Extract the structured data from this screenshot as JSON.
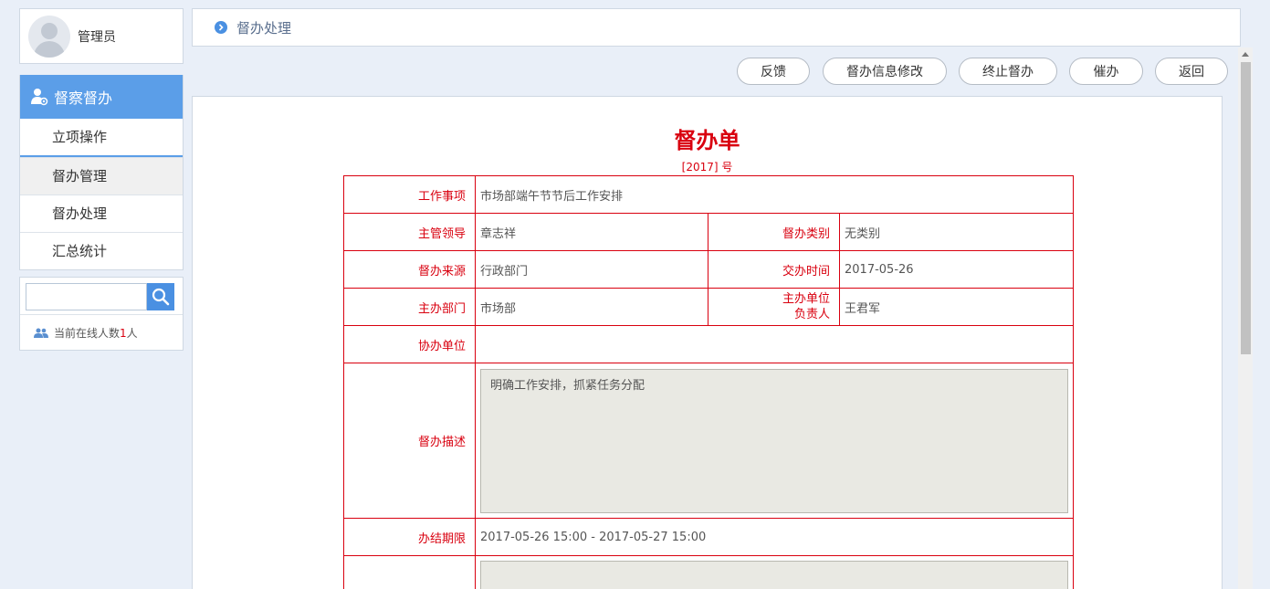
{
  "user": {
    "name": "管理员"
  },
  "nav": {
    "header": "督察督办",
    "items": [
      {
        "label": "立项操作"
      },
      {
        "label": "督办管理"
      },
      {
        "label": "督办处理"
      },
      {
        "label": "汇总统计"
      }
    ]
  },
  "search": {
    "placeholder": ""
  },
  "online": {
    "prefix": "当前在线人数",
    "count": "1",
    "suffix": "人"
  },
  "breadcrumb": {
    "title": "督办处理"
  },
  "toolbar": {
    "feedback": "反馈",
    "edit_info": "督办信息修改",
    "terminate": "终止督办",
    "urge": "催办",
    "back": "返回"
  },
  "form": {
    "title": "督办单",
    "number": "[2017] 号",
    "labels": {
      "work_item": "工作事项",
      "leader": "主管领导",
      "category": "督办类别",
      "source": "督办来源",
      "assign_time": "交办时间",
      "dept": "主办部门",
      "owner_line1": "主办单位",
      "owner_line2": "负责人",
      "assist": "协办单位",
      "description": "督办描述",
      "deadline": "办结期限"
    },
    "values": {
      "work_item": "市场部端午节节后工作安排",
      "leader": "章志祥",
      "category": "无类别",
      "source": "行政部门",
      "assign_time": "2017-05-26",
      "dept": "市场部",
      "owner": "王君军",
      "assist": "",
      "description": "明确工作安排，抓紧任务分配",
      "deadline": "2017-05-26 15:00 - 2017-05-27 15:00"
    }
  },
  "icons": {
    "nav_header": "user-settings-icon",
    "search": "search-icon",
    "online": "users-icon",
    "breadcrumb": "chevron-right-circle-icon"
  },
  "colors": {
    "accent": "#5b9ee8",
    "form_red": "#d9000f"
  }
}
